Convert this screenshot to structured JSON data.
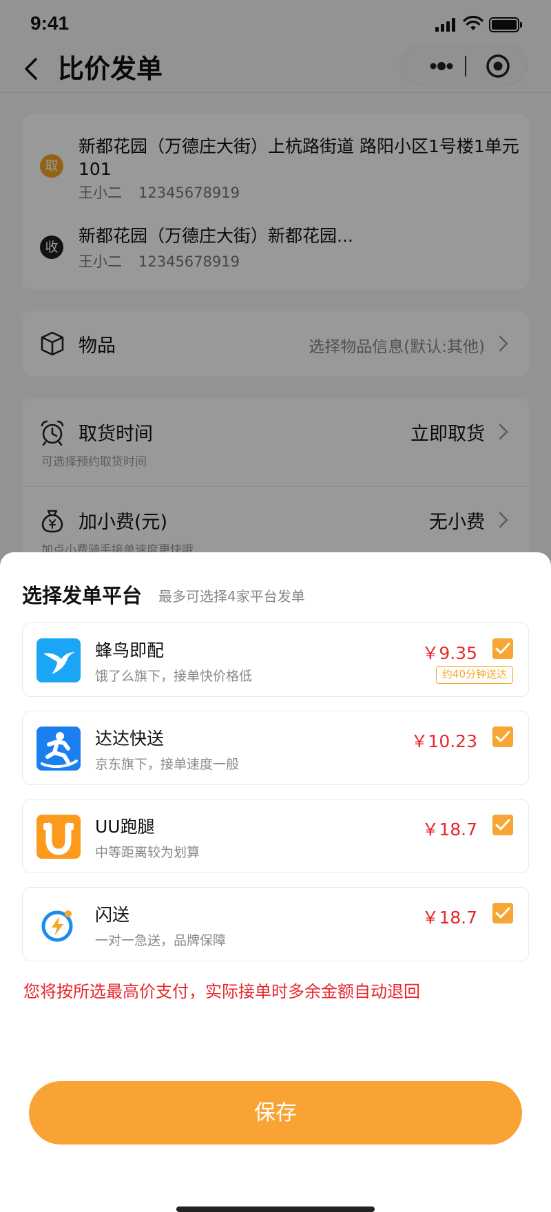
{
  "status_bar": {
    "time": "9:41"
  },
  "nav": {
    "title": "比价发单"
  },
  "pickup": {
    "badge": "取",
    "address": "新都花园（万德庄大街）上杭路街道 路阳小区1号楼1单元101",
    "name": "王小二",
    "phone": "12345678919"
  },
  "delivery": {
    "badge": "收",
    "address": "新都花园（万德庄大街）新都花园...",
    "name": "王小二",
    "phone": "12345678919"
  },
  "goods": {
    "label": "物品",
    "value": "选择物品信息(默认:其他)",
    "icon": "box-icon"
  },
  "pickup_time": {
    "label": "取货时间",
    "value": "立即取货",
    "sub": "可选择预约取货时间",
    "icon": "alarm-clock-icon"
  },
  "tip": {
    "label": "加小费(元)",
    "value": "无小费",
    "sub": "加点小费骑手接单速度更快哦",
    "icon": "money-bag-icon"
  },
  "sheet": {
    "title": "选择发单平台",
    "subtitle": "最多可选择4家平台发单",
    "platforms": [
      {
        "name": "蜂鸟即配",
        "desc": "饿了么旗下，接单快价格低",
        "price": "￥9.35",
        "eta": "约40分钟送达",
        "checked": true,
        "icon": "hummingbird-logo-icon",
        "color": "#1aa5f5"
      },
      {
        "name": "达达快送",
        "desc": "京东旗下，接单速度一般",
        "price": "￥10.23",
        "checked": true,
        "icon": "dada-runner-logo-icon",
        "color": "#1c7ff0"
      },
      {
        "name": "UU跑腿",
        "desc": "中等距离较为划算",
        "price": "￥18.7",
        "checked": true,
        "icon": "uu-logo-icon",
        "color": "#fb9a1d"
      },
      {
        "name": "闪送",
        "desc": "一对一急送，品牌保障",
        "price": "￥18.7",
        "checked": true,
        "icon": "shansong-logo-icon",
        "color": "#1a8cf0"
      }
    ],
    "notice": "您将按所选最高价支付，实际接单时多余金额自动退回",
    "save_label": "保存"
  },
  "colors": {
    "accent": "#f8a333",
    "price_red": "#e8262b"
  }
}
